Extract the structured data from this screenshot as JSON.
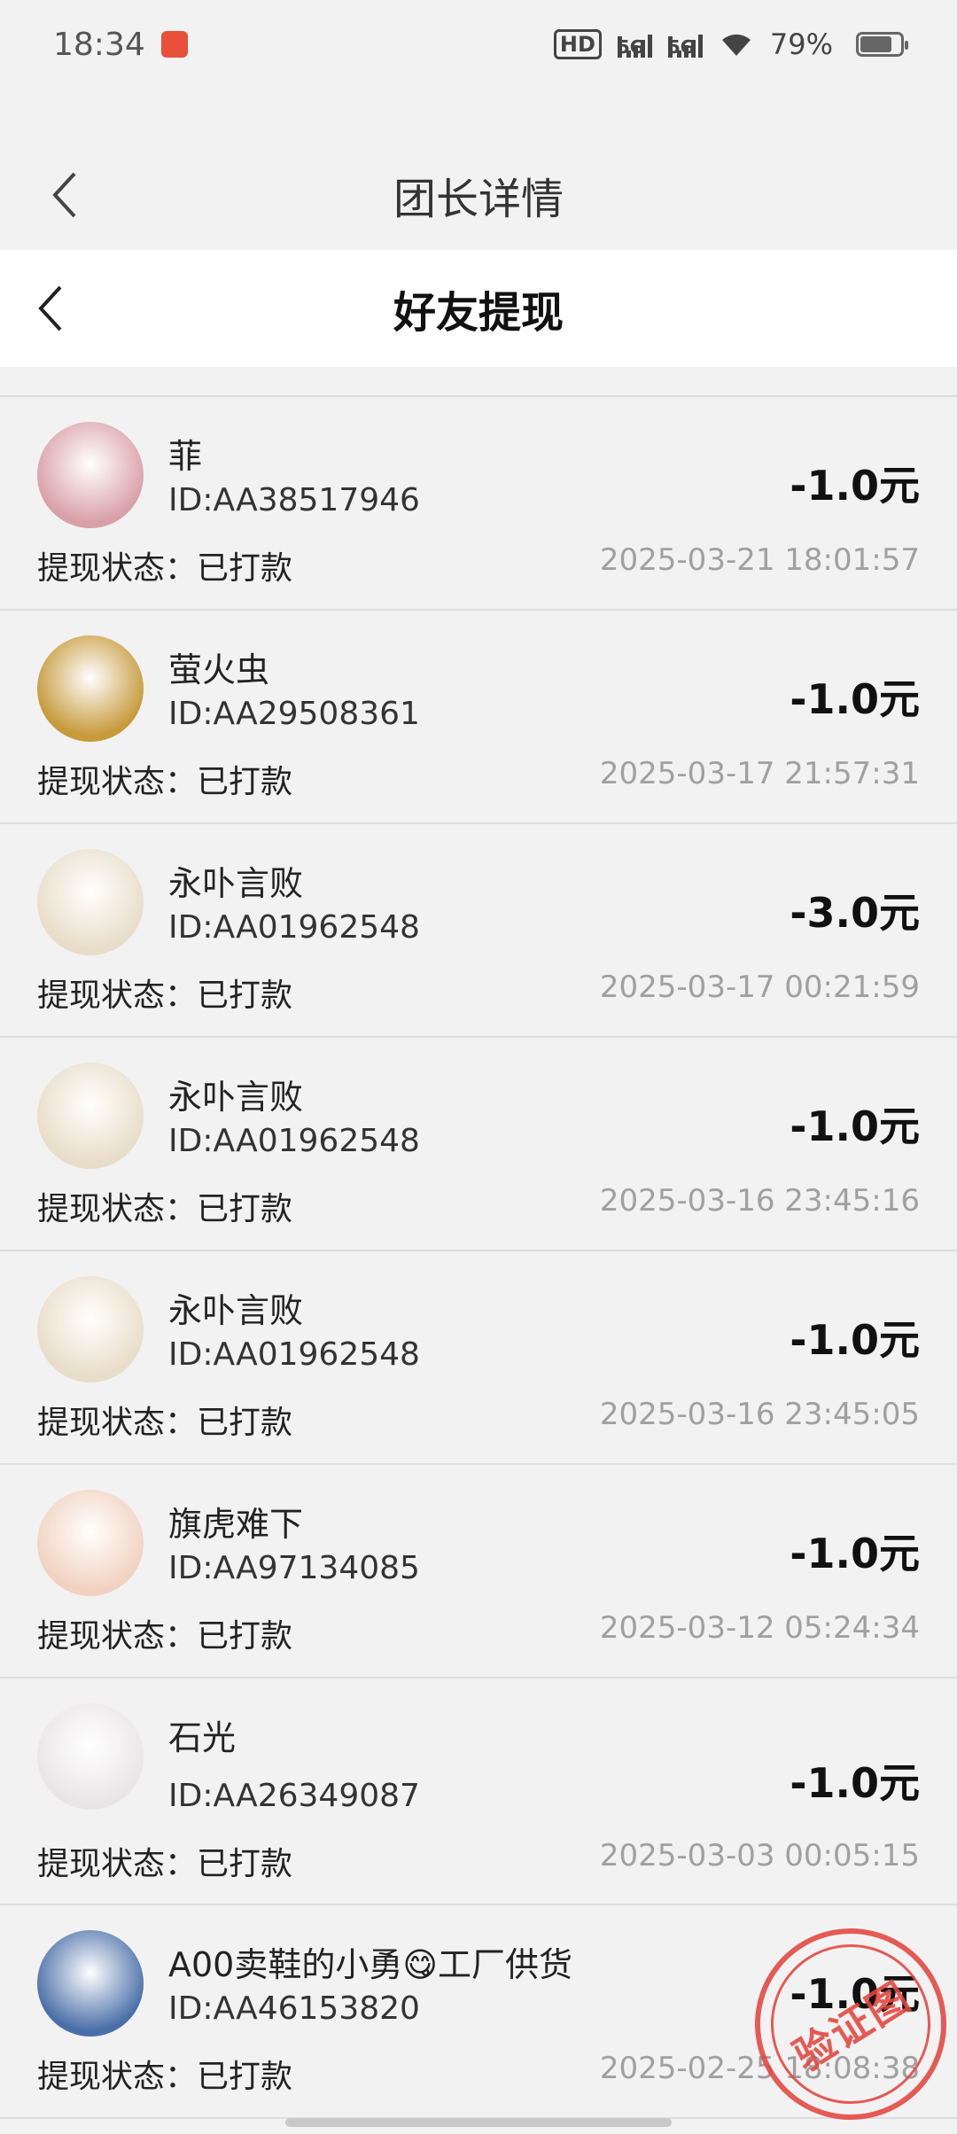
{
  "status_bar": {
    "time": "18:34",
    "network_hd": "HD",
    "network_5g_1": "5G",
    "network_5g_2": "5G",
    "battery_text": "79%",
    "battery_level": 0.79
  },
  "outer_header": {
    "title": "团长详情"
  },
  "inner_header": {
    "title": "好友提现"
  },
  "items": [
    {
      "name": "菲",
      "id": "ID:AA38517946",
      "amount": "-1.0元",
      "status": "提现状态：已打款",
      "time": "2025-03-21 18:01:57",
      "avatar_color": "#d9a0a8"
    },
    {
      "name": "萤火虫",
      "id": "ID:AA29508361",
      "amount": "-1.0元",
      "status": "提现状态：已打款",
      "time": "2025-03-17 21:57:31",
      "avatar_color": "#c79a3a"
    },
    {
      "name": "永卟言败",
      "id": "ID:AA01962548",
      "amount": "-3.0元",
      "status": "提现状态：已打款",
      "time": "2025-03-17 00:21:59",
      "avatar_color": "#e8ddc8"
    },
    {
      "name": "永卟言败",
      "id": "ID:AA01962548",
      "amount": "-1.0元",
      "status": "提现状态：已打款",
      "time": "2025-03-16 23:45:16",
      "avatar_color": "#e8ddc8"
    },
    {
      "name": "永卟言败",
      "id": "ID:AA01962548",
      "amount": "-1.0元",
      "status": "提现状态：已打款",
      "time": "2025-03-16 23:45:05",
      "avatar_color": "#e8ddc8"
    },
    {
      "name": "旗虎难下",
      "id": "ID:AA97134085",
      "amount": "-1.0元",
      "status": "提现状态：已打款",
      "time": "2025-03-12 05:24:34",
      "avatar_color": "#f1d2c0"
    },
    {
      "name": "石光",
      "id": "ID:AA26349087",
      "amount": "-1.0元",
      "status": "提现状态：已打款",
      "time": "2025-03-03 00:05:15",
      "avatar_color": "#e9e5e7"
    },
    {
      "name": "A00卖鞋的小勇😋工厂供货",
      "id": "ID:AA46153820",
      "amount": "-1.0元",
      "status": "提现状态：已打款",
      "time": "2025-02-25 18:08:38",
      "avatar_color": "#4a6fa8"
    }
  ],
  "stamp": {
    "text": "验证图"
  }
}
